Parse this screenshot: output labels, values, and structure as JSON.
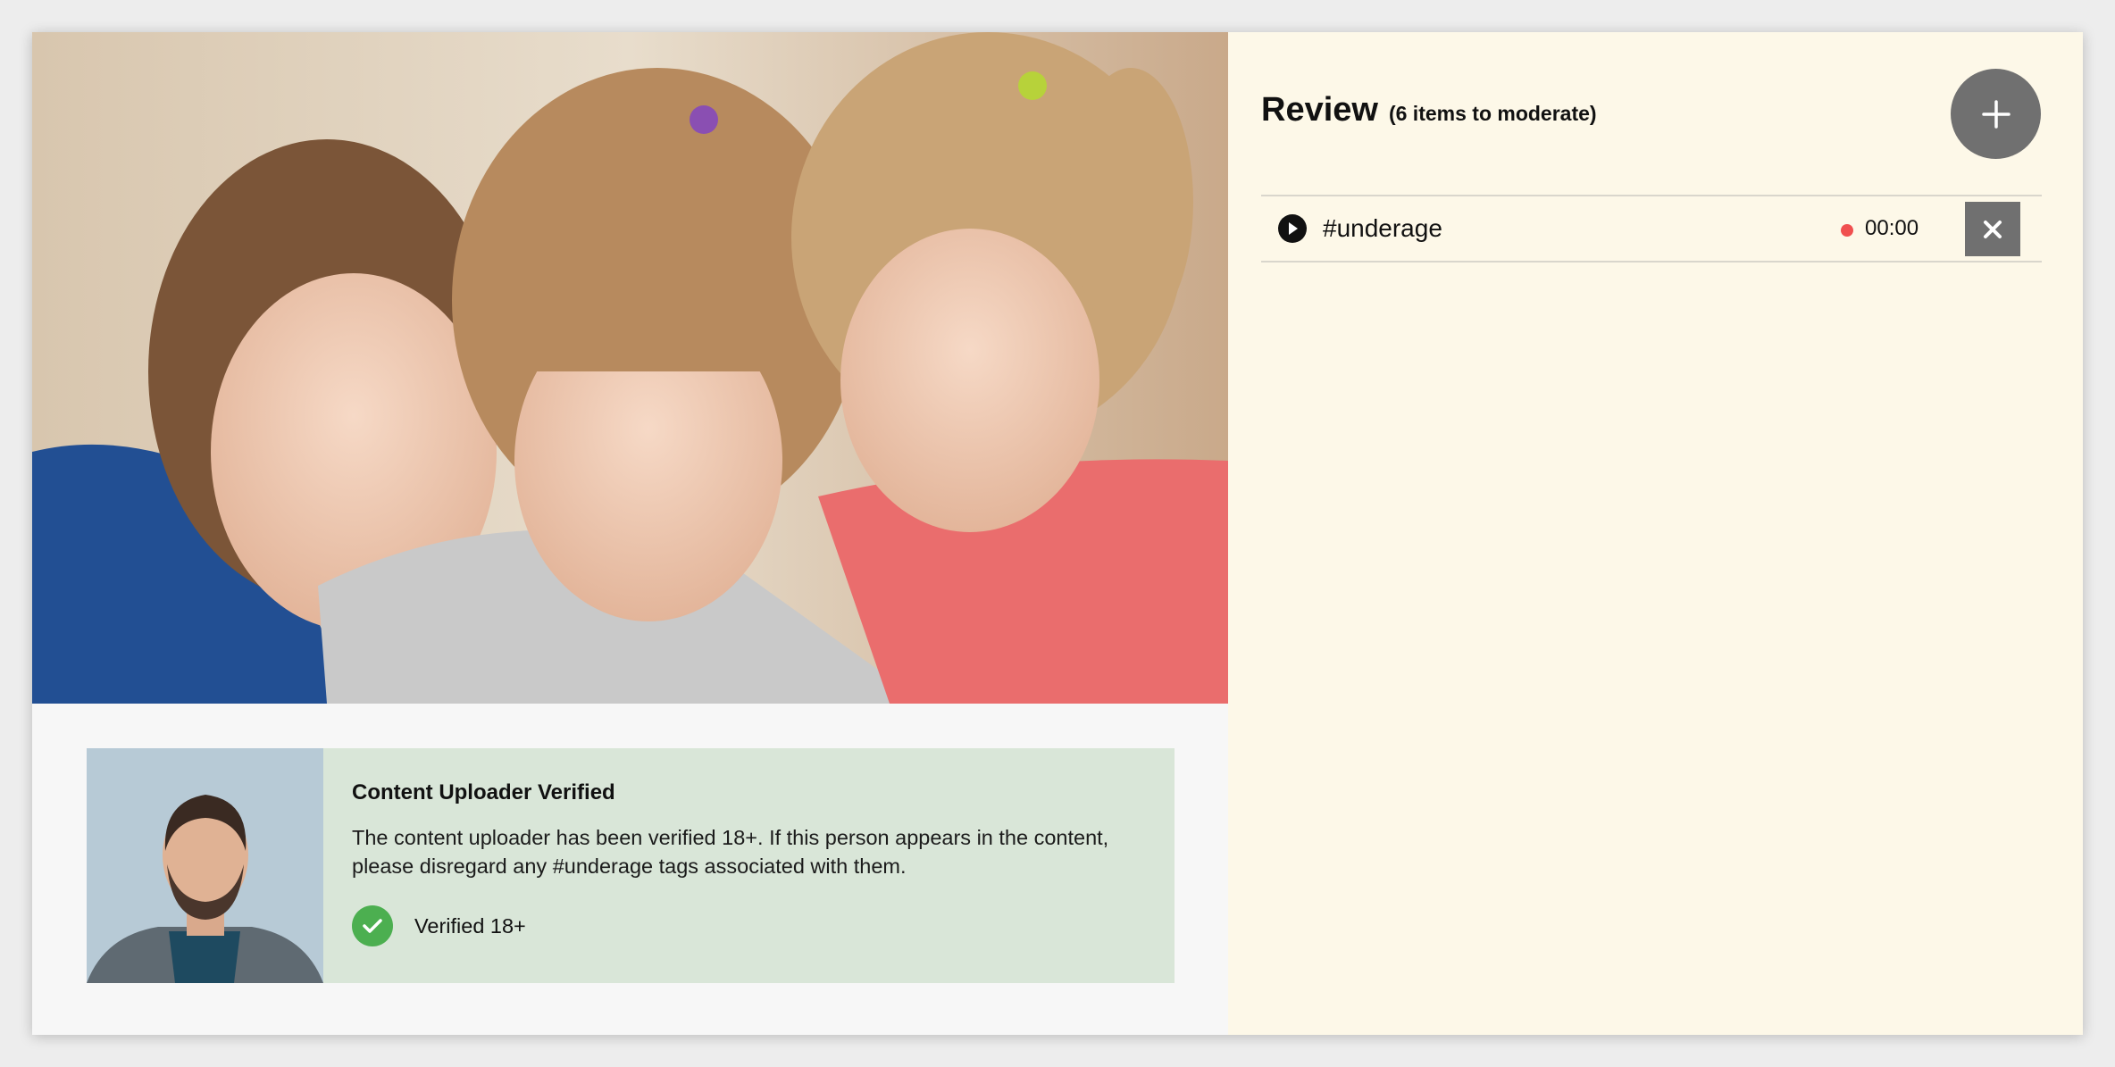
{
  "review": {
    "title": "Review",
    "subtitle": "(6 items to moderate)",
    "items": [
      {
        "tag": "#underage",
        "time": "00:00"
      }
    ]
  },
  "uploader": {
    "title": "Content Uploader Verified",
    "description": "The content uploader has been verified 18+. If this person appears in the content, please disregard any #underage tags associated with them.",
    "status_label": "Verified 18+"
  },
  "colors": {
    "review_panel_bg": "#fdf8e8",
    "uploader_card_bg": "#d9e6d8",
    "verified_green": "#4caf50",
    "recording_dot": "#f0504f",
    "button_gray": "#707070"
  },
  "icons": [
    "plus-icon",
    "play-icon",
    "close-icon",
    "check-icon"
  ]
}
